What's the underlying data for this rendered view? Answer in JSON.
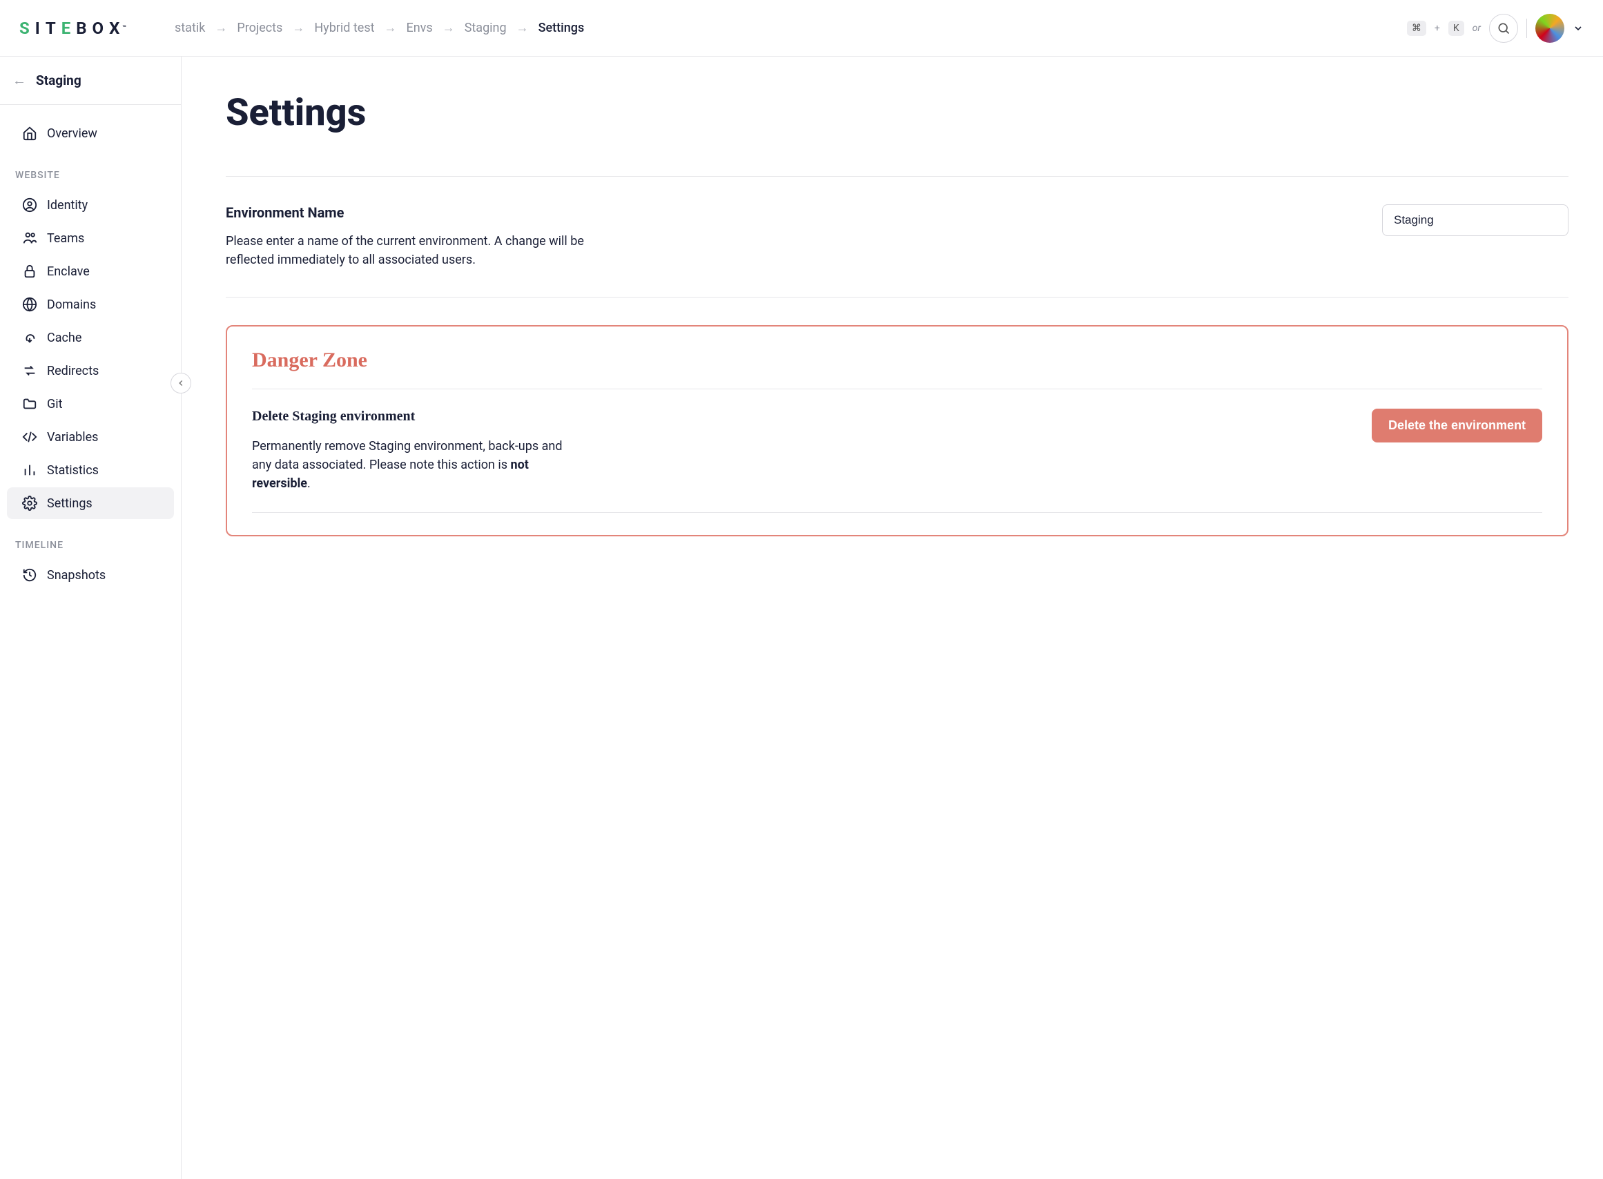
{
  "logo": {
    "text": "SITEBOX"
  },
  "breadcrumbs": {
    "items": [
      "statik",
      "Projects",
      "Hybrid test",
      "Envs",
      "Staging"
    ],
    "current": "Settings"
  },
  "header": {
    "cmd_key": "⌘",
    "plus": "+",
    "k_key": "K",
    "or": "or"
  },
  "sidebar": {
    "back_label": "Staging",
    "overview": "Overview",
    "section_website": "WEBSITE",
    "identity": "Identity",
    "teams": "Teams",
    "enclave": "Enclave",
    "domains": "Domains",
    "cache": "Cache",
    "redirects": "Redirects",
    "git": "Git",
    "variables": "Variables",
    "statistics": "Statistics",
    "settings": "Settings",
    "section_timeline": "TIMELINE",
    "snapshots": "Snapshots"
  },
  "main": {
    "title": "Settings",
    "env_name_label": "Environment Name",
    "env_name_desc": "Please enter a name of the current environment. A change will be reflected immediately to all associated users.",
    "env_name_value": "Staging",
    "danger": {
      "title": "Danger Zone",
      "subtitle": "Delete Staging environment",
      "desc_part1": "Permanently remove Staging environment, back-ups and any data associated. Please note this action is ",
      "desc_bold": "not reversible",
      "desc_part2": ".",
      "button": "Delete the environment"
    }
  }
}
